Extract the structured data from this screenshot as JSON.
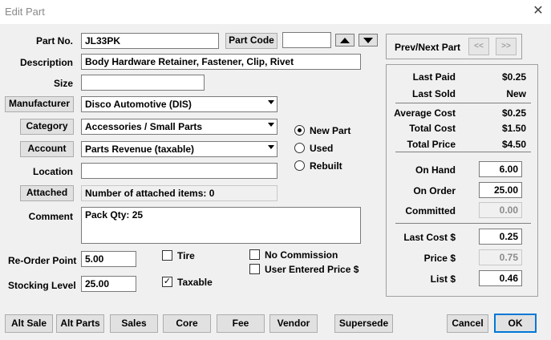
{
  "window": {
    "title": "Edit Part",
    "close": "✕"
  },
  "form": {
    "part_no_label": "Part No.",
    "part_no": "JL33PK",
    "part_code_button": "Part Code",
    "part_code_value": "",
    "description_label": "Description",
    "description": "Body Hardware Retainer, Fastener, Clip, Rivet",
    "size_label": "Size",
    "size": "",
    "manufacturer_button": "Manufacturer",
    "manufacturer": "Disco Automotive (DIS)",
    "category_button": "Category",
    "category": "Accessories / Small Parts",
    "account_button": "Account",
    "account": "Parts Revenue (taxable)",
    "location_label": "Location",
    "location": "",
    "attached_button": "Attached",
    "attached_text": "Number of attached items: 0",
    "comment_label": "Comment",
    "comment": "Pack Qty: 25",
    "reorder_label": "Re-Order Point",
    "reorder": "5.00",
    "stocking_label": "Stocking Level",
    "stocking": "25.00"
  },
  "condition": {
    "new_label": "New Part",
    "new_checked": true,
    "used_label": "Used",
    "used_checked": false,
    "rebuilt_label": "Rebuilt",
    "rebuilt_checked": false
  },
  "checks": {
    "tire_label": "Tire",
    "tire_checked": false,
    "taxable_label": "Taxable",
    "taxable_checked": true,
    "no_commission_label": "No Commission",
    "no_commission_checked": false,
    "user_price_label": "User Entered Price $",
    "user_price_checked": false,
    "check_mark": "✓"
  },
  "nav": {
    "label": "Prev/Next Part",
    "prev": "<<",
    "next": ">>"
  },
  "stats": {
    "last_paid_label": "Last Paid",
    "last_paid": "$0.25",
    "last_sold_label": "Last Sold",
    "last_sold": "New",
    "avg_cost_label": "Average Cost",
    "avg_cost": "$0.25",
    "total_cost_label": "Total Cost",
    "total_cost": "$1.50",
    "total_price_label": "Total Price",
    "total_price": "$4.50",
    "on_hand_label": "On Hand",
    "on_hand": "6.00",
    "on_order_label": "On Order",
    "on_order": "25.00",
    "committed_label": "Committed",
    "committed": "0.00",
    "last_cost_label": "Last Cost $",
    "last_cost": "0.25",
    "price_label": "Price $",
    "price": "0.75",
    "list_label": "List $",
    "list": "0.46"
  },
  "bottom_buttons": {
    "alt_sale": "Alt Sale",
    "alt_parts": "Alt Parts",
    "sales": "Sales",
    "core": "Core",
    "fee": "Fee",
    "vendor": "Vendor",
    "supersede": "Supersede",
    "cancel": "Cancel",
    "ok": "OK"
  }
}
